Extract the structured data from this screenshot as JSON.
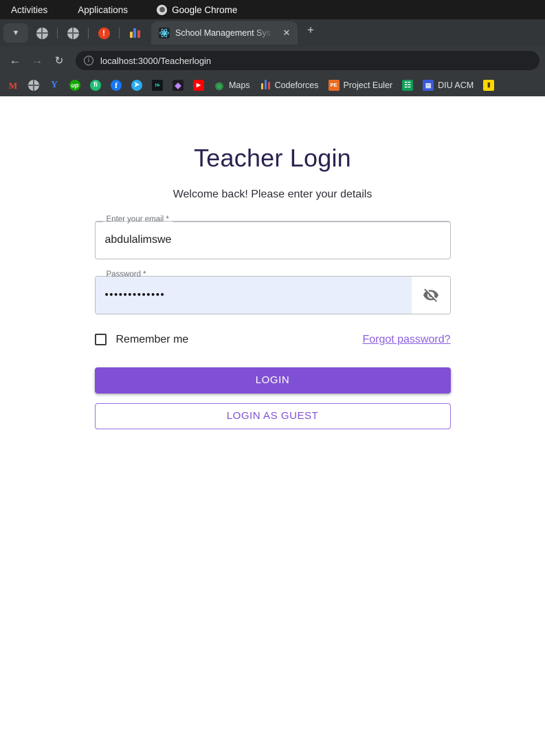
{
  "os_bar": {
    "activities": "Activities",
    "applications": "Applications",
    "app_name": "Google Chrome",
    "app_icon": "chrome-icon"
  },
  "browser": {
    "tabstrip_buttons": [
      {
        "name": "tab-group-chevron",
        "icon": "chevron-down-icon",
        "label": ""
      },
      {
        "name": "pinned-tab-globe-1",
        "icon": "globe-icon",
        "label": ""
      },
      {
        "name": "pinned-tab-globe-2",
        "icon": "globe-icon",
        "label": ""
      },
      {
        "name": "pinned-tab-alert",
        "icon": "alert-circle-icon",
        "label": ""
      },
      {
        "name": "pinned-tab-chart",
        "icon": "bar-chart-icon",
        "label": ""
      }
    ],
    "tab": {
      "title": "School Management Sys",
      "favicon": "react-logo-icon",
      "close_label": "✕"
    },
    "new_tab_label": "+",
    "nav": {
      "back": "←",
      "forward": "→",
      "reload": "↻"
    },
    "omnibox": {
      "site_info_icon": "info-circle-icon",
      "url": "localhost:3000/Teacherlogin"
    },
    "bookmarks": [
      {
        "label": "",
        "icon": "gmail-icon",
        "glyph": "M",
        "cls": "ico-gmail"
      },
      {
        "label": "",
        "icon": "globe-icon",
        "glyph": "",
        "cls": "ico-globe2"
      },
      {
        "label": "",
        "icon": "y-icon",
        "glyph": "Y",
        "cls": "ico-y"
      },
      {
        "label": "",
        "icon": "upwork-icon",
        "glyph": "up",
        "cls": "ico-up"
      },
      {
        "label": "",
        "icon": "fiverr-icon",
        "glyph": "fi",
        "cls": "ico-fi"
      },
      {
        "label": "",
        "icon": "facebook-icon",
        "glyph": "f",
        "cls": "ico-fb"
      },
      {
        "label": "",
        "icon": "telegram-icon",
        "glyph": "➤",
        "cls": "ico-tg"
      },
      {
        "label": "",
        "icon": "hackerearth-icon",
        "glyph": "H▪",
        "cls": "ico-hb"
      },
      {
        "label": "",
        "icon": "diamond-icon",
        "glyph": "◆",
        "cls": "ico-dm"
      },
      {
        "label": "",
        "icon": "youtube-icon",
        "glyph": "▶",
        "cls": "ico-yt"
      },
      {
        "label": "Maps",
        "icon": "google-maps-icon",
        "glyph": "◉",
        "cls": "ico-maps"
      },
      {
        "label": "Codeforces",
        "icon": "codeforces-icon",
        "glyph": "",
        "cls": "ico-cf"
      },
      {
        "label": "Project Euler",
        "icon": "project-euler-icon",
        "glyph": "PE",
        "cls": "ico-pe"
      },
      {
        "label": "",
        "icon": "google-sheets-icon",
        "glyph": "☷",
        "cls": "ico-sheets"
      },
      {
        "label": "DIU ACM",
        "icon": "diu-acm-icon",
        "glyph": "▤",
        "cls": "ico-diu"
      },
      {
        "label": "",
        "icon": "yellow-bookmark-icon",
        "glyph": "⦀",
        "cls": "ico-last"
      }
    ]
  },
  "login": {
    "title": "Teacher Login",
    "subtitle": "Welcome back! Please enter your details",
    "email": {
      "label": "Enter your email *",
      "value": "abdulalimswe",
      "placeholder": ""
    },
    "password": {
      "label": "Password *",
      "value": "•••••••••••••",
      "toggle_icon": "eye-off-icon"
    },
    "remember_label": "Remember me",
    "forgot_label": "Forgot password?",
    "login_button": "LOGIN",
    "guest_button": "LOGIN AS GUEST"
  },
  "colors": {
    "accent_purple": "#8050d4",
    "link_purple": "#8c5ee0",
    "title_navy": "#2b2250",
    "autofill_blue": "#e8eefb"
  }
}
